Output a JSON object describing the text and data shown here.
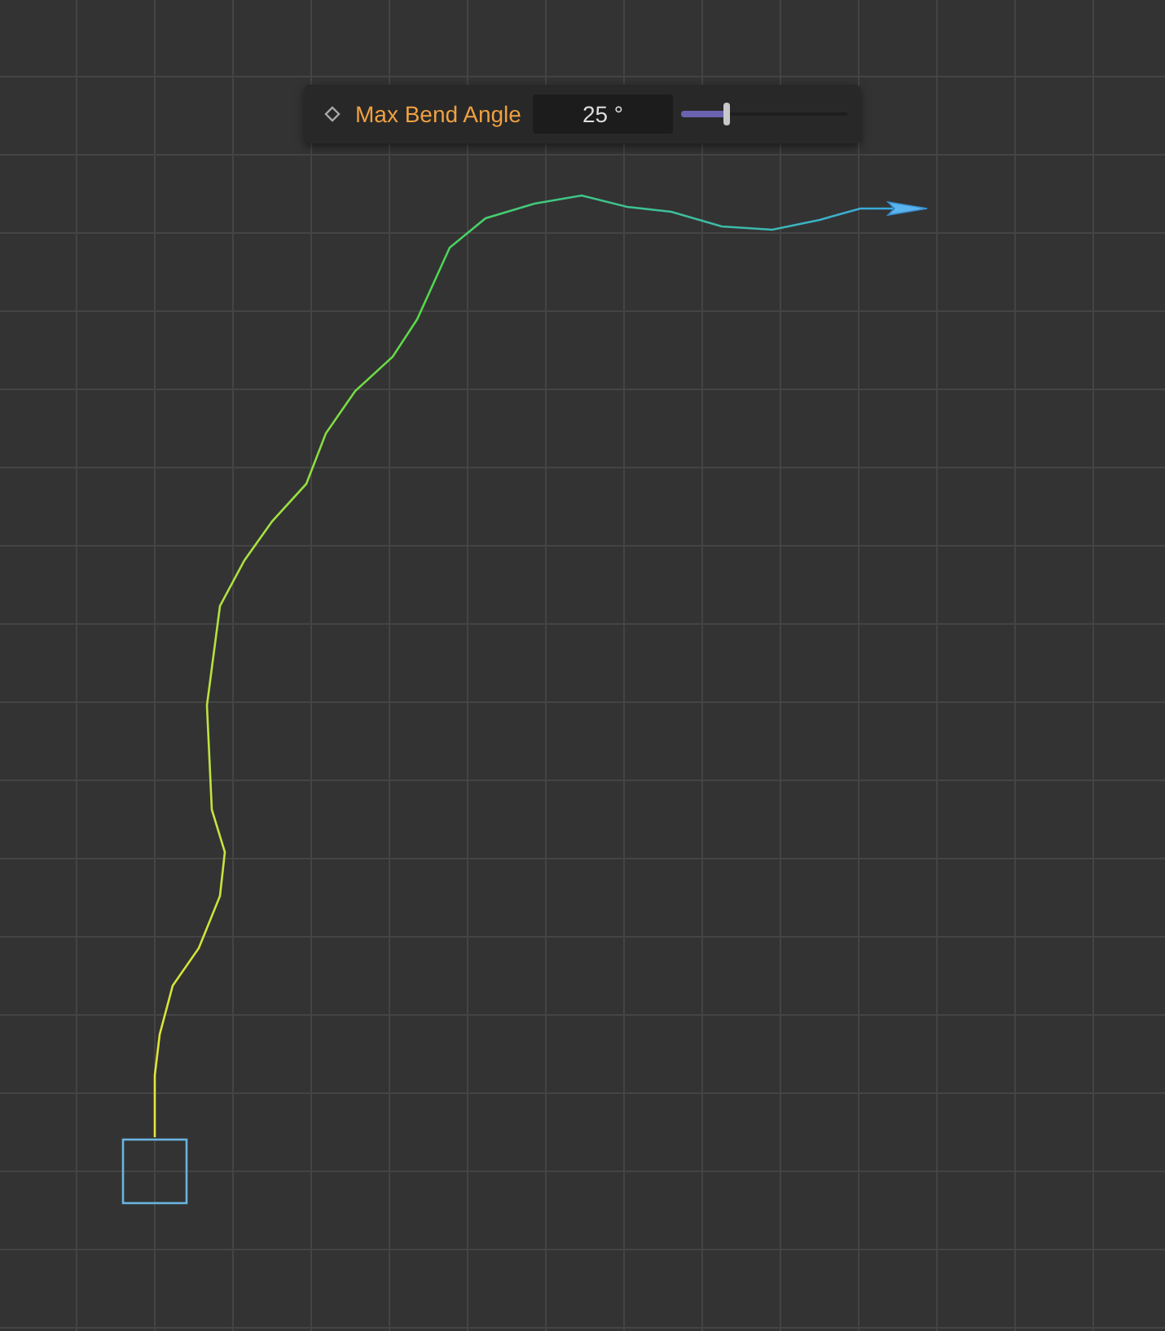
{
  "parameter_bar": {
    "label": "Max Bend Angle",
    "value": "25 °",
    "slider": {
      "level": 0.27
    }
  }
}
